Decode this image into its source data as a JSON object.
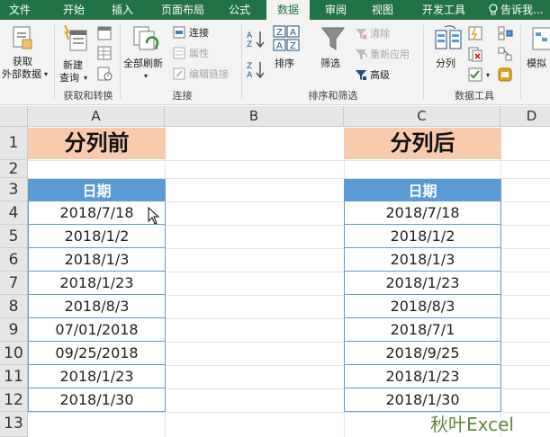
{
  "tabs": [
    "文件",
    "开始",
    "插入",
    "页面布局",
    "公式",
    "数据",
    "审阅",
    "视图",
    "开发工具",
    "告诉我..."
  ],
  "active_tab": "数据",
  "ribbon": {
    "get_external": [
      "获取",
      "外部数据"
    ],
    "new_query": [
      "新建",
      "查询"
    ],
    "refresh_all": "全部刷新",
    "connections": "连接",
    "properties": "属性",
    "edit_links": "编辑链接",
    "sort": "排序",
    "filter": "筛选",
    "clear": "清除",
    "reapply": "重新应用",
    "advanced": "高级",
    "text_to_columns": "分列",
    "whatif": "模拟",
    "group_labels": [
      "获取和转换",
      "连接",
      "排序和筛选",
      "数据工具"
    ]
  },
  "columns": [
    "A",
    "B",
    "C",
    "D"
  ],
  "rows": [
    "1",
    "2",
    "3",
    "4",
    "5",
    "6",
    "7",
    "8",
    "9",
    "10",
    "11",
    "12",
    "13"
  ],
  "left_table": {
    "title": "分列前",
    "header": "日期",
    "values": [
      "2018/7/18",
      "2018/1/2",
      "2018/1/3",
      "2018/1/23",
      "2018/8/3",
      "07/01/2018",
      "09/25/2018",
      "2018/1/23",
      "2018/1/30"
    ]
  },
  "right_table": {
    "title": "分列后",
    "header": "日期",
    "values": [
      "2018/7/18",
      "2018/1/2",
      "2018/1/3",
      "2018/1/23",
      "2018/8/3",
      "2018/7/1",
      "2018/9/25",
      "2018/1/23",
      "2018/1/30"
    ]
  },
  "watermark": "秋叶Excel",
  "colors": {
    "brand": "#217346",
    "title_fill": "#f8cbad",
    "header_fill": "#5b9bd5"
  }
}
